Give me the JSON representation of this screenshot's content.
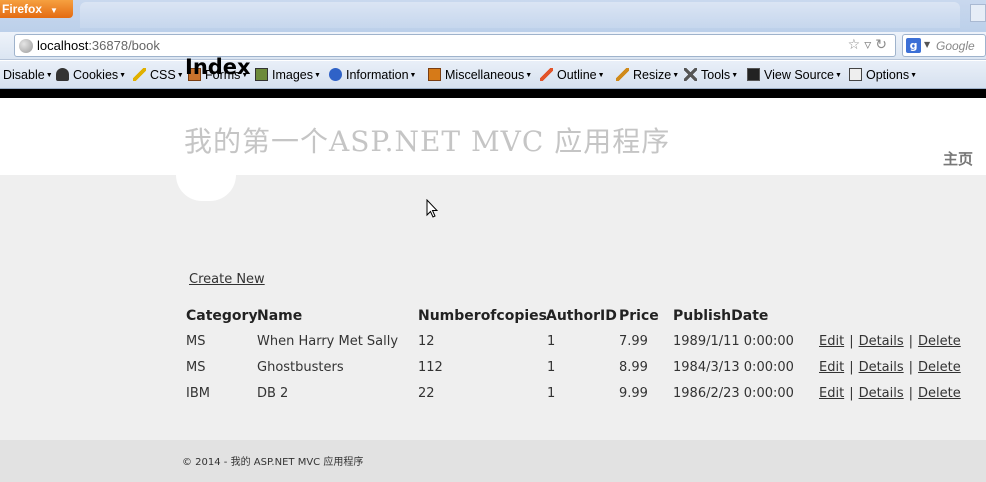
{
  "browser": {
    "app_button": "Firefox",
    "url_host": "localhost",
    "url_rest": ":36878/book",
    "search_placeholder": "Google",
    "search_engine_icon": "g-icon"
  },
  "devbar": {
    "items": [
      {
        "label": "Disable",
        "icon": "disable-icon"
      },
      {
        "label": "Cookies",
        "icon": "cookies-icon"
      },
      {
        "label": "CSS",
        "icon": "css-icon"
      },
      {
        "label": "Forms",
        "icon": "forms-icon"
      },
      {
        "label": "Images",
        "icon": "images-icon"
      },
      {
        "label": "Information",
        "icon": "information-icon"
      },
      {
        "label": "Miscellaneous",
        "icon": "miscellaneous-icon"
      },
      {
        "label": "Outline",
        "icon": "outline-icon"
      },
      {
        "label": "Resize",
        "icon": "resize-icon"
      },
      {
        "label": "Tools",
        "icon": "tools-icon"
      },
      {
        "label": "View Source",
        "icon": "view-source-icon"
      },
      {
        "label": "Options",
        "icon": "options-icon"
      }
    ]
  },
  "site": {
    "title": "我的第一个ASP.NET MVC 应用程序",
    "home_link": "主页"
  },
  "page": {
    "heading": "Index",
    "create_link": "Create New"
  },
  "table": {
    "headers": [
      "Category",
      "Name",
      "Numberofcopies",
      "AuthorID",
      "Price",
      "PublishDate"
    ],
    "rows": [
      {
        "category": "MS",
        "name": "When Harry Met Sally",
        "copies": "12",
        "author": "1",
        "price": "7.99",
        "date": "1989/1/11 0:00:00"
      },
      {
        "category": "MS",
        "name": "Ghostbusters",
        "copies": "112",
        "author": "1",
        "price": "8.99",
        "date": "1984/3/13 0:00:00"
      },
      {
        "category": "IBM",
        "name": "DB 2",
        "copies": "22",
        "author": "1",
        "price": "9.99",
        "date": "1986/2/23 0:00:00"
      }
    ],
    "actions": {
      "edit": "Edit",
      "details": "Details",
      "delete": "Delete",
      "separator": "|"
    }
  },
  "footer": {
    "text": "© 2014 - 我的 ASP.NET MVC 应用程序"
  },
  "colors": {
    "firefox_orange": "#e46b12",
    "header_bg": "#ffffff",
    "content_bg": "#efefef",
    "footer_bg": "#e2e2e2",
    "title_gray": "#c5c5c5"
  }
}
